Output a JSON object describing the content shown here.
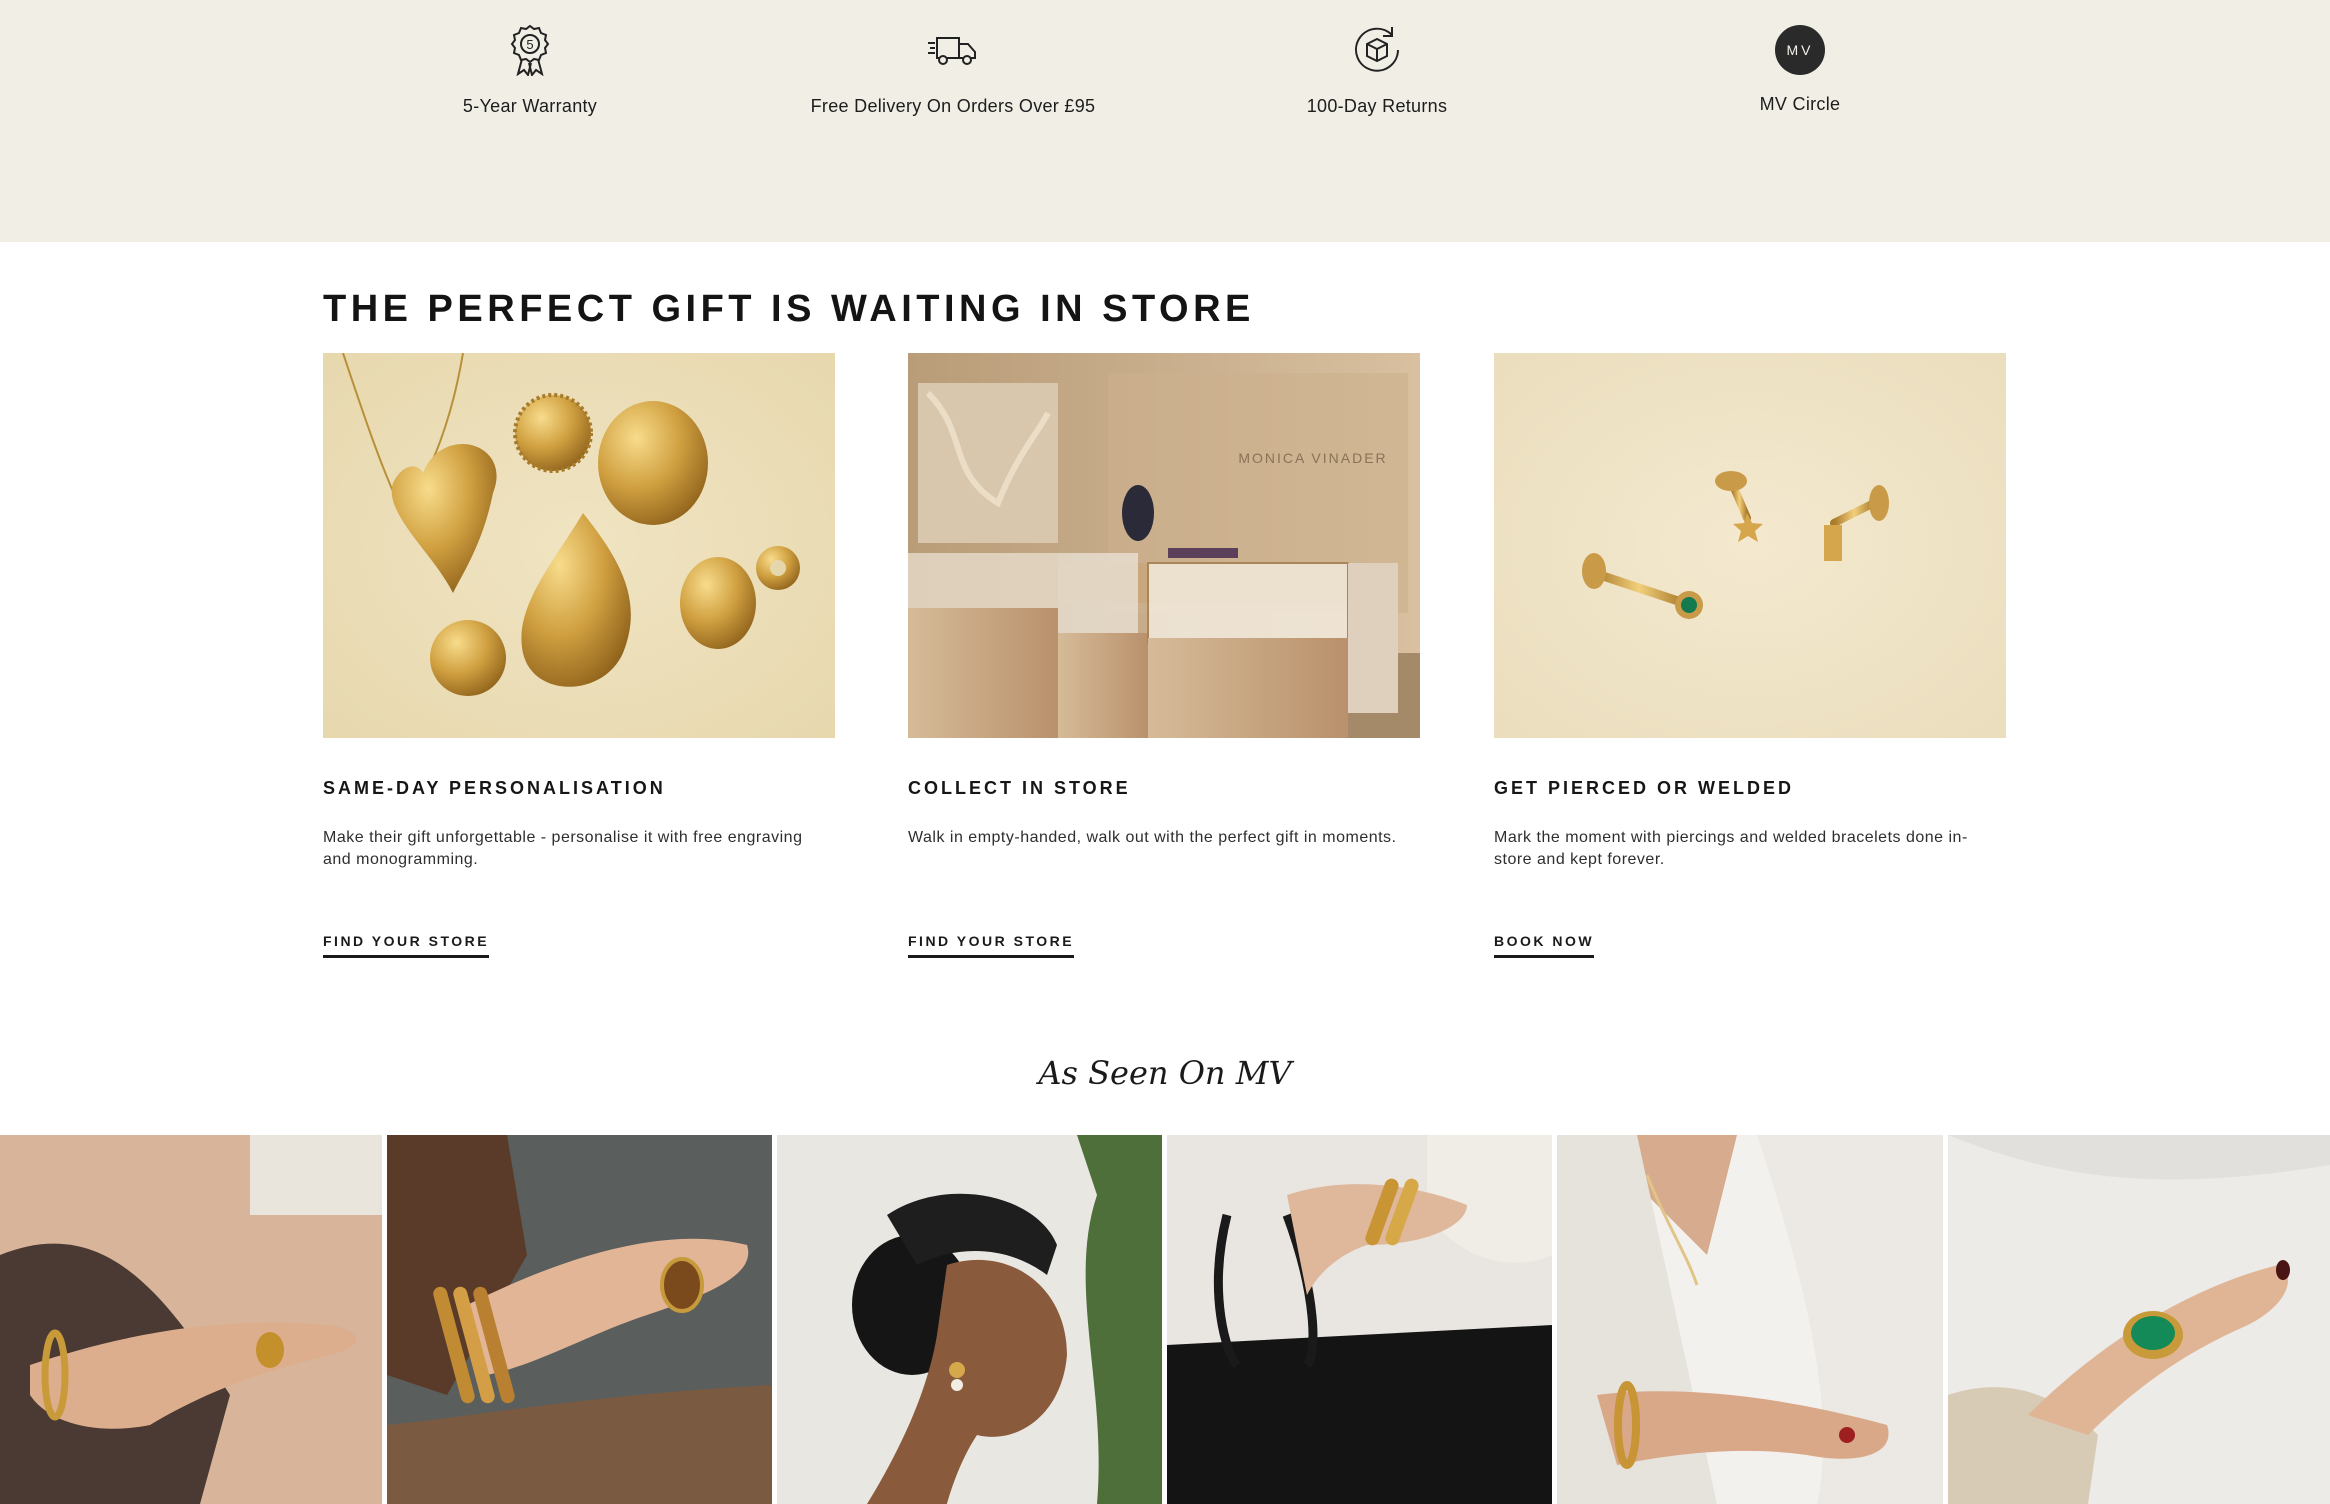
{
  "benefits": [
    {
      "label": "5-Year Warranty",
      "icon": "warranty-rosette-icon"
    },
    {
      "label": "Free Delivery On Orders Over £95",
      "icon": "delivery-truck-icon"
    },
    {
      "label": "100-Day Returns",
      "icon": "returns-box-icon"
    },
    {
      "label": "MV Circle",
      "icon": "mv-circle-badge",
      "badge_text": "MV"
    }
  ],
  "store_section": {
    "title": "THE PERFECT GIFT IS WAITING IN STORE",
    "cards": [
      {
        "title": "SAME-DAY PERSONALISATION",
        "description": "Make their gift unforgettable - personalise it with free engraving and monogramming.",
        "link": "FIND YOUR STORE"
      },
      {
        "title": "COLLECT IN STORE",
        "description": "Walk in empty-handed, walk out with the perfect gift in moments.",
        "link": "FIND YOUR STORE"
      },
      {
        "title": "GET PIERCED OR WELDED",
        "description": "Mark the moment with piercings and welded bracelets done in-store and kept forever.",
        "link": "BOOK NOW"
      }
    ]
  },
  "store_sign_text": "MONICA VINADER",
  "seen_on": {
    "title": "As Seen On MV"
  },
  "colors": {
    "benefits_bg": "#f1eee6",
    "text": "#141414",
    "gold": "#c9a04a"
  }
}
